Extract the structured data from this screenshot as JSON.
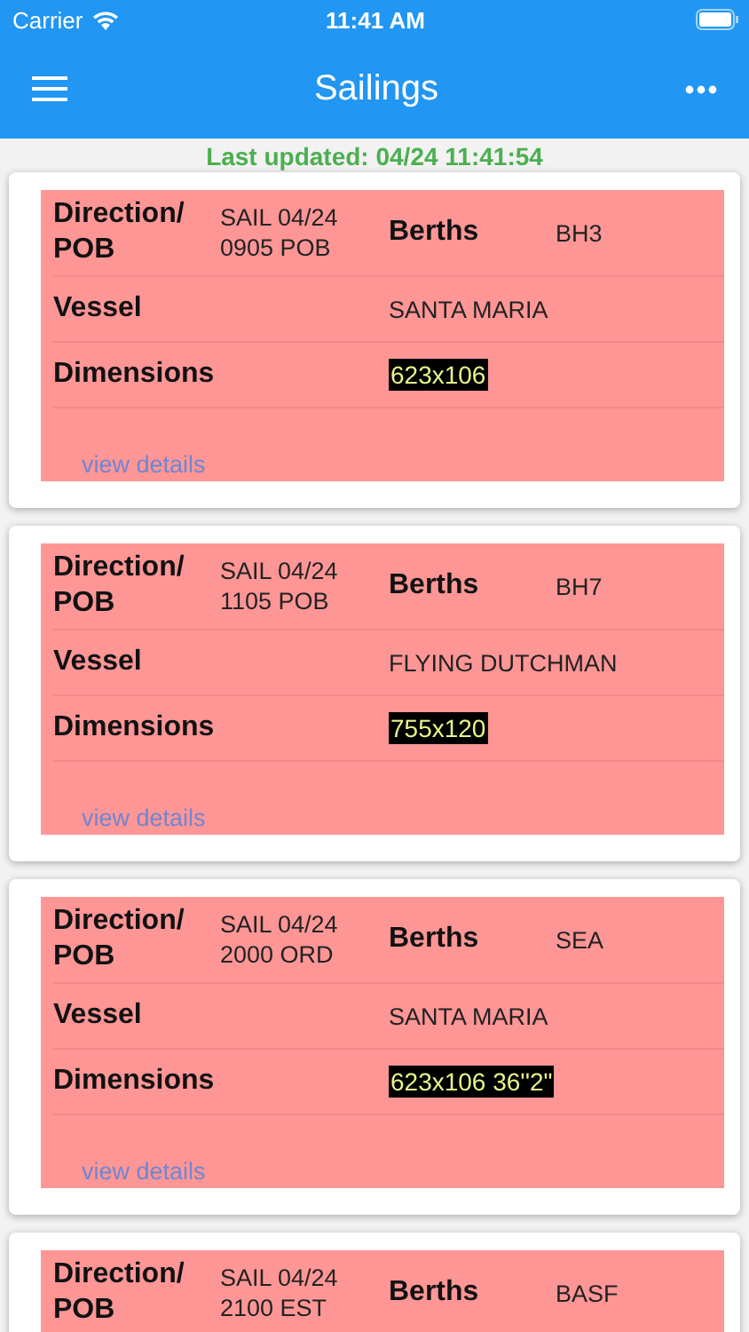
{
  "status_bar": {
    "carrier": "Carrier",
    "time": "11:41 AM"
  },
  "nav_bar": {
    "title": "Sailings"
  },
  "last_updated": "Last updated: 04/24 11:41:54",
  "sailings": [
    {
      "direction_label": "Direction/ POB",
      "direction": "SAIL 04/24 0905 POB",
      "berths_label": "Berths",
      "berths": "BH3",
      "vessel_label": "Vessel",
      "vessel": "SANTA MARIA",
      "dimensions_label": "Dimensions",
      "dimensions": "623x106",
      "link": "view details"
    },
    {
      "direction_label": "Direction/ POB",
      "direction": "SAIL 04/24 1105 POB",
      "berths_label": "Berths",
      "berths": "BH7",
      "vessel_label": "Vessel",
      "vessel": "FLYING DUTCHMAN",
      "dimensions_label": "Dimensions",
      "dimensions": "755x120",
      "link": "view details"
    },
    {
      "direction_label": "Direction/ POB",
      "direction": "SAIL 04/24 2000 ORD",
      "berths_label": "Berths",
      "berths": "SEA",
      "vessel_label": "Vessel",
      "vessel": "SANTA MARIA",
      "dimensions_label": "Dimensions",
      "dimensions": "623x106 36''2\"",
      "link": "view details"
    },
    {
      "direction_label": "Direction/ POB",
      "direction": "SAIL 04/24 2100 EST",
      "berths_label": "Berths",
      "berths": "BASF"
    }
  ]
}
